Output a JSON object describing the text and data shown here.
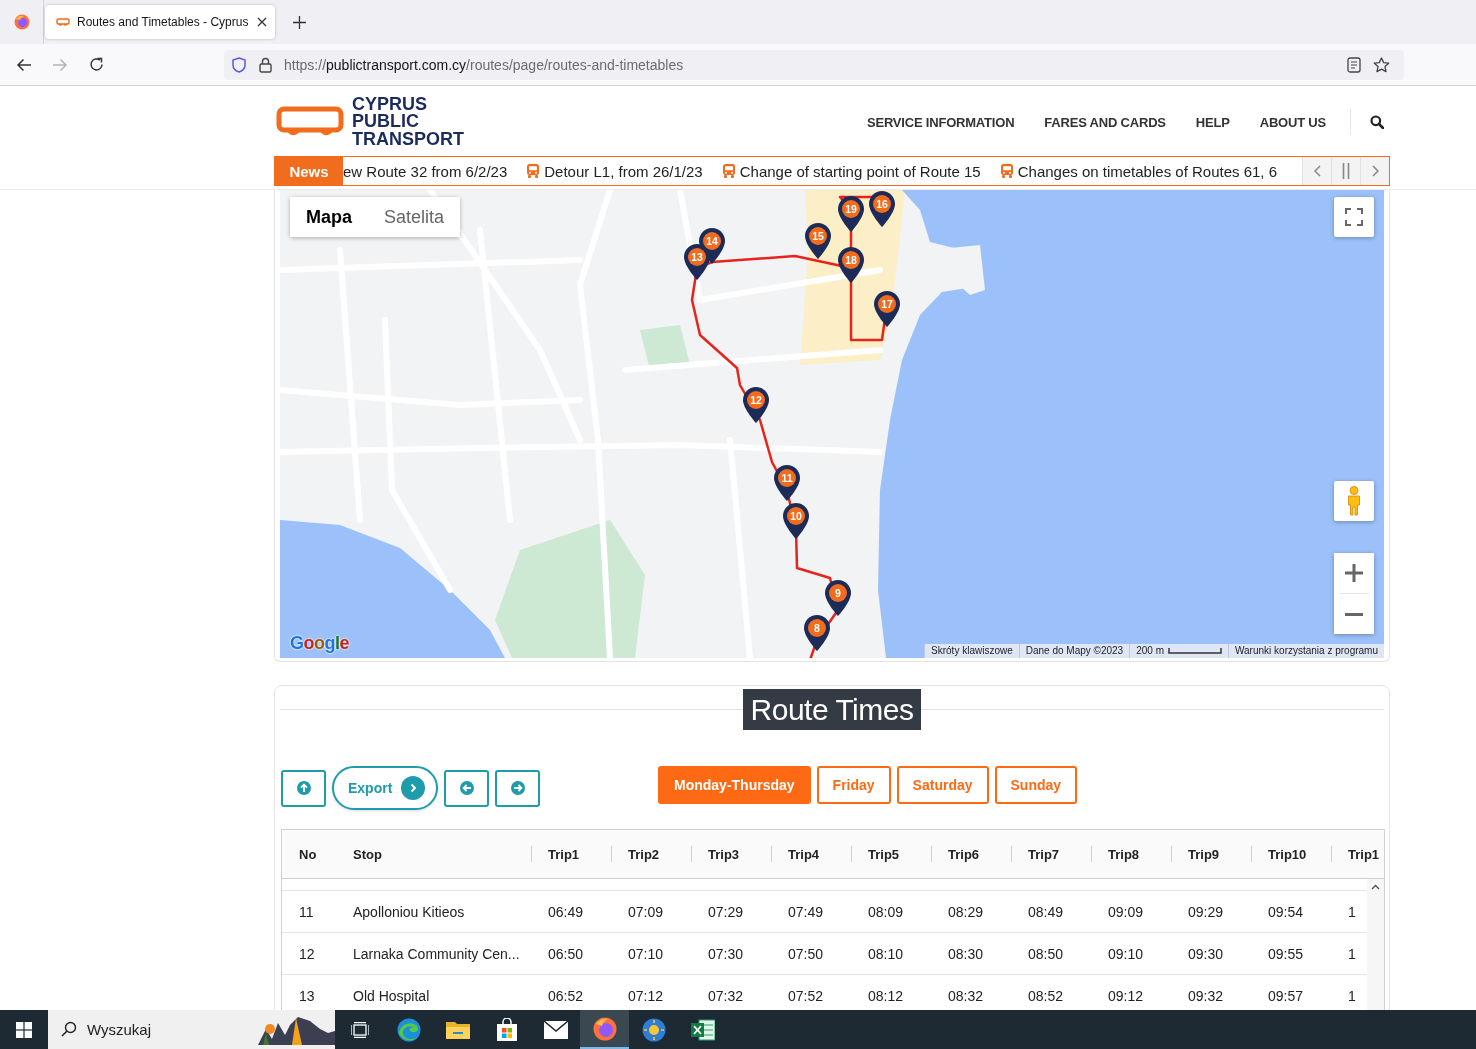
{
  "browser": {
    "tab": {
      "title": "Routes and Timetables - Cyprus",
      "selected": true
    },
    "nav_buttons": [
      {
        "kind": "back",
        "disabled": false
      },
      {
        "kind": "forward",
        "disabled": true
      },
      {
        "kind": "reload",
        "disabled": false
      }
    ],
    "url": {
      "scheme": "https://",
      "host": "publictransport.com.cy",
      "path": "/routes/page/routes-and-timetables"
    }
  },
  "site_header": {
    "logo_lines": [
      "CYPRUS",
      "PUBLIC",
      "TRANSPORT"
    ],
    "menu": [
      "SERVICE INFORMATION",
      "FARES AND CARDS",
      "HELP",
      "ABOUT US"
    ]
  },
  "news_ticker": {
    "label": "News",
    "items": [
      {
        "text": "ew Route 32 from 6/2/23",
        "bus_icon": false
      },
      {
        "text": "Detour L1, from 26/1/23",
        "bus_icon": true
      },
      {
        "text": "Change of starting point of Route 15",
        "bus_icon": true
      },
      {
        "text": "Changes on timetables of Routes 61, 6",
        "bus_icon": true
      }
    ]
  },
  "map": {
    "type_tabs": [
      {
        "label": "Mapa",
        "selected": true
      },
      {
        "label": "Satelita",
        "selected": false
      }
    ],
    "stop_markers": [
      "19",
      "16",
      "15",
      "14",
      "13",
      "18",
      "17",
      "12",
      "11",
      "10",
      "9",
      "8"
    ],
    "logo": "Google",
    "attribution": {
      "shortcuts": "Skróty klawiszowe",
      "data": "Dane do Mapy ©2023",
      "scale": "200 m",
      "terms": "Warunki korzystania z programu"
    }
  },
  "route_times": {
    "title": "Route Times",
    "export_label": "Export",
    "days": [
      {
        "label": "Monday-Thursday",
        "selected": true
      },
      {
        "label": "Friday",
        "selected": false
      },
      {
        "label": "Saturday",
        "selected": false
      },
      {
        "label": "Sunday",
        "selected": false
      }
    ],
    "table": {
      "columns": [
        "No",
        "Stop",
        "Trip1",
        "Trip2",
        "Trip3",
        "Trip4",
        "Trip5",
        "Trip6",
        "Trip7",
        "Trip8",
        "Trip9",
        "Trip10",
        "Trip1"
      ],
      "rows": [
        [
          "11",
          "Apolloniou Kitieos",
          "06:49",
          "07:09",
          "07:29",
          "07:49",
          "08:09",
          "08:29",
          "08:49",
          "09:09",
          "09:29",
          "09:54",
          "1"
        ],
        [
          "12",
          "Larnaka Community Cen...",
          "06:50",
          "07:10",
          "07:30",
          "07:50",
          "08:10",
          "08:30",
          "08:50",
          "09:10",
          "09:30",
          "09:55",
          "1"
        ],
        [
          "13",
          "Old Hospital",
          "06:52",
          "07:12",
          "07:32",
          "07:52",
          "08:12",
          "08:32",
          "08:52",
          "09:12",
          "09:32",
          "09:57",
          "1"
        ]
      ]
    }
  },
  "taskbar": {
    "search_placeholder": "Wyszukaj",
    "apps": [
      {
        "kind": "taskview",
        "active": false
      },
      {
        "kind": "wave",
        "active": false
      },
      {
        "kind": "folder",
        "active": false
      },
      {
        "kind": "bag",
        "active": false
      },
      {
        "kind": "envelope",
        "active": false
      },
      {
        "kind": "fox",
        "active": true
      },
      {
        "kind": "sun",
        "active": false
      },
      {
        "kind": "sheet",
        "active": false
      }
    ]
  }
}
